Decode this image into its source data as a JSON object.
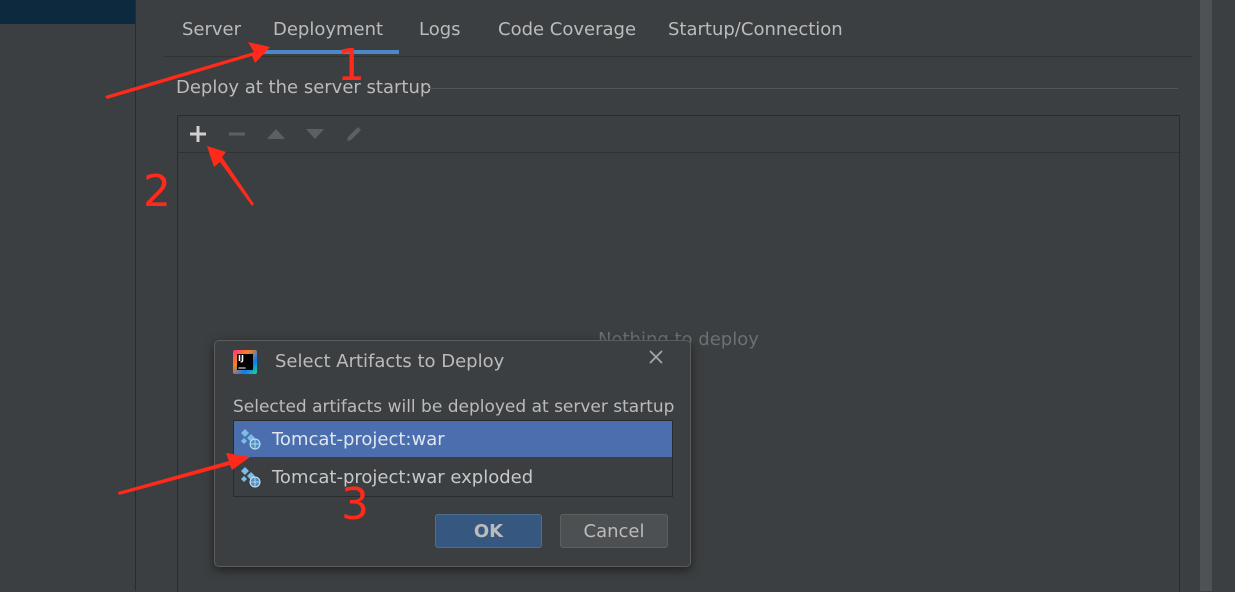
{
  "tabs": [
    {
      "label": "Server"
    },
    {
      "label": "Deployment"
    },
    {
      "label": "Logs"
    },
    {
      "label": "Code Coverage"
    },
    {
      "label": "Startup/Connection"
    }
  ],
  "active_tab": "Deployment",
  "deploy_group": {
    "title": "Deploy at the server startup",
    "empty_text": "Nothing to deploy"
  },
  "toolbar": {
    "add_icon": "plus-icon",
    "remove_icon": "minus-icon",
    "up_icon": "move-up-icon",
    "down_icon": "move-down-icon",
    "edit_icon": "pencil-icon"
  },
  "dialog": {
    "title": "Select Artifacts to Deploy",
    "description": "Selected artifacts will be deployed at server startup",
    "artifacts": [
      {
        "label": "Tomcat-project:war",
        "selected": true
      },
      {
        "label": "Tomcat-project:war exploded",
        "selected": false
      }
    ],
    "ok_label": "OK",
    "cancel_label": "Cancel"
  },
  "annotations": {
    "step1": "1",
    "step2": "2",
    "step3": "3",
    "color": "#ff2a1a"
  },
  "colors": {
    "background": "#3c3f41",
    "selection": "#4b6eaf",
    "tab_underline": "#4a88c7",
    "ok_button": "#365880"
  }
}
